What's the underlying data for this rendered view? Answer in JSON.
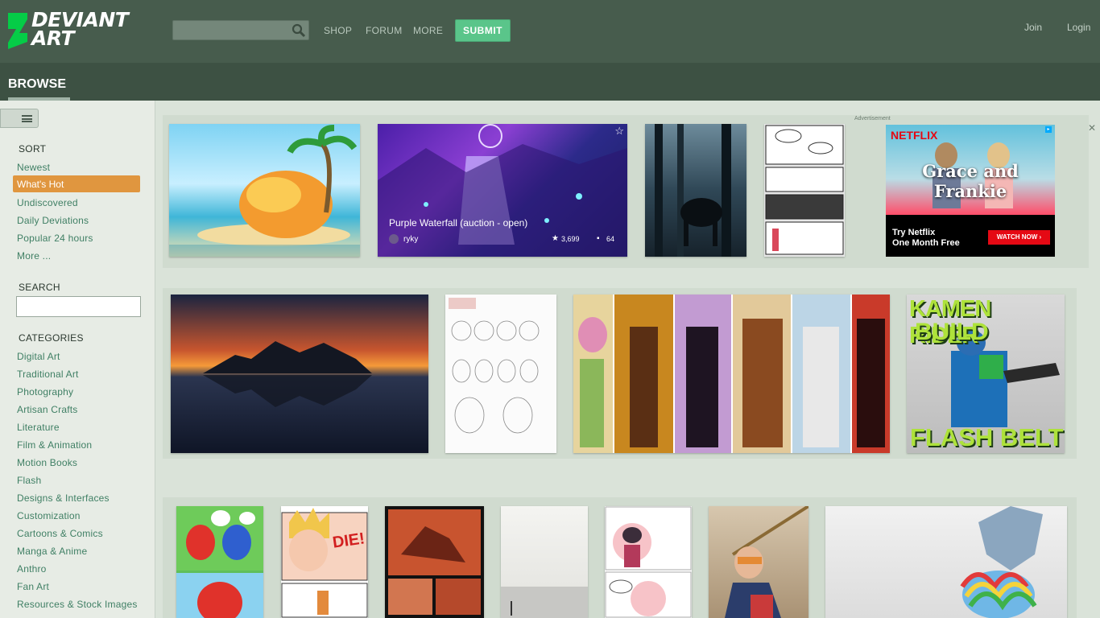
{
  "header": {
    "logo_line1": "DEVIANT",
    "logo_line2": "ART",
    "search_placeholder": "",
    "nav": [
      "SHOP",
      "FORUM",
      "MORE"
    ],
    "submit_label": "SUBMIT",
    "join_label": "Join",
    "login_label": "Login"
  },
  "browse": {
    "title": "BROWSE"
  },
  "sidebar": {
    "sort_heading": "SORT",
    "sort_items": [
      "Newest",
      "What's Hot",
      "Undiscovered",
      "Daily Deviations",
      "Popular 24 hours",
      "More ..."
    ],
    "active_sort": "What's Hot",
    "search_heading": "SEARCH",
    "search_value": "",
    "categories_heading": "CATEGORIES",
    "categories": [
      "Digital Art",
      "Traditional Art",
      "Photography",
      "Artisan Crafts",
      "Literature",
      "Film & Animation",
      "Motion Books",
      "Flash",
      "Designs & Interfaces",
      "Customization",
      "Cartoons & Comics",
      "Manga & Anime",
      "Anthro",
      "Fan Art",
      "Resources & Stock Images"
    ]
  },
  "featured": {
    "title": "Purple Waterfall (auction - open)",
    "user": "ryky",
    "favs": "3,699",
    "comments": "64"
  },
  "ad": {
    "label": "Advertisement",
    "brand": "NETFLIX",
    "show": "Grace and Frankie",
    "cta_line1": "Try Netflix",
    "cta_line2": "One Month Free",
    "button": "WATCH NOW ›"
  },
  "thumb_text": {
    "kamen1": "KAMEN RIDER",
    "kamen2": "BUILD",
    "kamen3": "FLASH BELT",
    "die": "DIE!"
  },
  "colors": {
    "header": "#475c4d",
    "browsebar": "#3d5143",
    "submit": "#5ac58a",
    "active": "#e0963f",
    "link": "#3f7f64"
  }
}
